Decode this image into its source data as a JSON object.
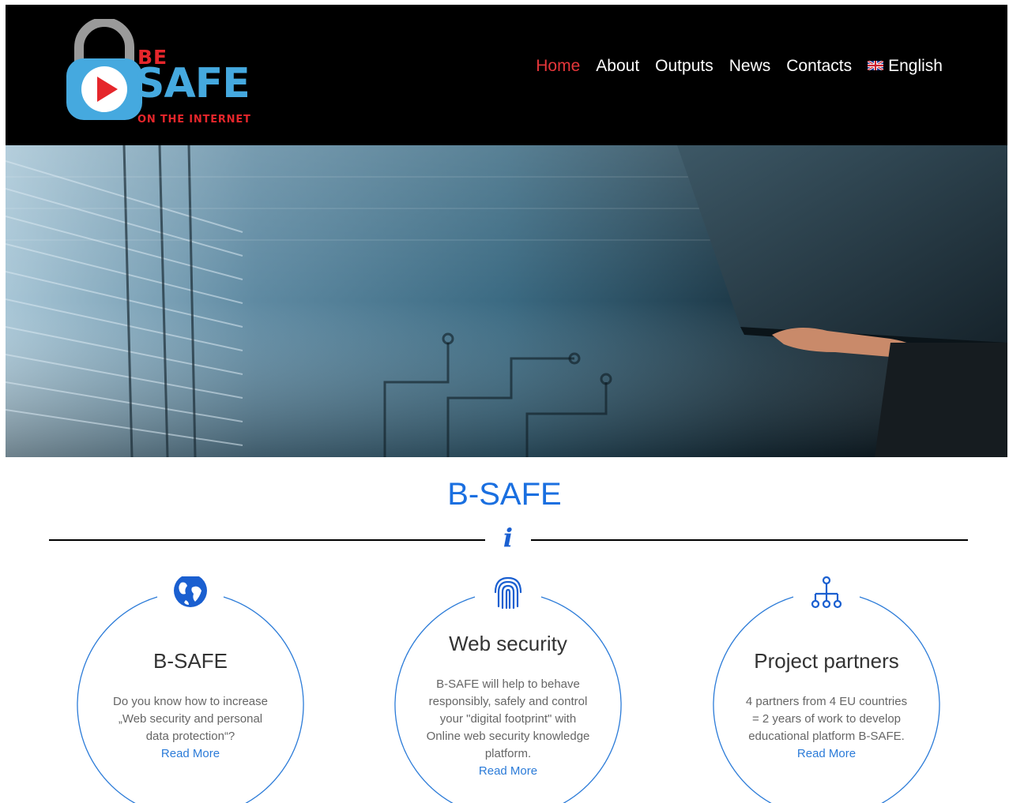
{
  "header": {
    "logo": {
      "line1": "BE",
      "line2": "SAFE",
      "line3": "ON THE INTERNET"
    },
    "nav": [
      {
        "label": "Home",
        "active": true
      },
      {
        "label": "About"
      },
      {
        "label": "Outputs"
      },
      {
        "label": "News"
      },
      {
        "label": "Contacts"
      },
      {
        "label": "English",
        "icon": "uk-flag-icon"
      }
    ]
  },
  "section": {
    "title": "B-SAFE",
    "divider_icon": "i"
  },
  "cards": [
    {
      "icon": "globe-icon",
      "title": "B-SAFE",
      "text_lines": [
        "Do you know how to increase",
        "„Web security and personal",
        "data protection“?"
      ],
      "link": "Read More"
    },
    {
      "icon": "fingerprint-icon",
      "title": "Web security",
      "text_lines": [
        "B-SAFE will help to behave",
        "responsibly, safely and control",
        "your \"digital footprint\" with",
        "Online web security knowledge",
        "platform."
      ],
      "link": "Read More"
    },
    {
      "icon": "network-icon",
      "title": "Project partners",
      "text_lines": [
        "4 partners from 4 EU countries",
        "= 2 years of work to develop",
        "educational platform B-SAFE."
      ],
      "link": "Read More"
    }
  ],
  "colors": {
    "accent_blue": "#1a6fe0",
    "logo_red": "#e5262b",
    "logo_blue": "#45a9df",
    "nav_active": "#e5363a"
  }
}
